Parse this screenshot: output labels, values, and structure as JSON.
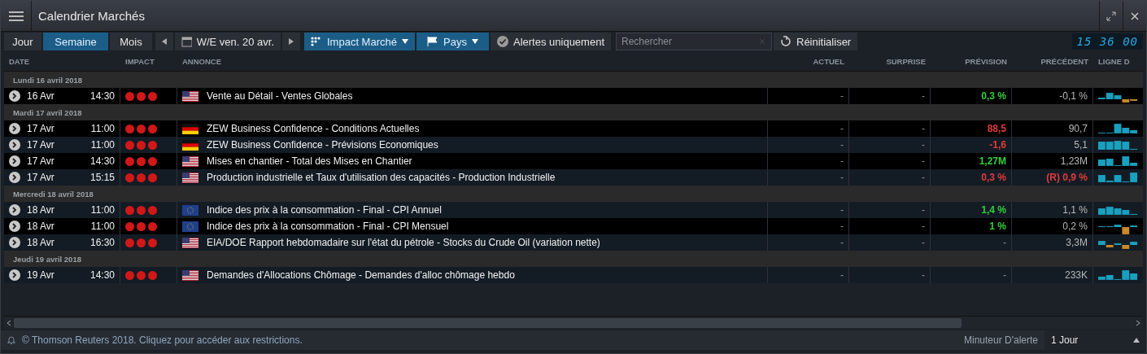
{
  "window": {
    "title": "Calendrier Marchés"
  },
  "toolbar": {
    "periods": [
      {
        "label": "Jour",
        "selected": false
      },
      {
        "label": "Semaine",
        "selected": true
      },
      {
        "label": "Mois",
        "selected": false
      }
    ],
    "date": "W/E ven. 20 avr.",
    "impact_filter": "Impact Marché",
    "country_filter": "Pays",
    "alerts": "Alertes uniquement",
    "search": {
      "placeholder": "Rechercher"
    },
    "reset": "Réinitialiser",
    "clock": "15 36 00"
  },
  "table": {
    "columns": [
      "DATE",
      "IMPACT",
      "ANNONCE",
      "ACTUEL",
      "SURPRISE",
      "PRÉVISION",
      "PRÉCÉDENT",
      "LIGNE D"
    ],
    "groups": [
      {
        "title": "Lundi 16 avril 2018",
        "rows": [
          {
            "date": "16 Avr",
            "time": "14:30",
            "stars": 3,
            "flag": {
              "kind": "us"
            },
            "event": "Vente au Détail - Ventes Globales",
            "actual": "-",
            "surprise": "-",
            "forecast": {
              "text": "0,3 %",
              "color": "#2fd03a"
            },
            "previous": "-0,1 %",
            "revised": false,
            "highlighted": false
          }
        ]
      },
      {
        "title": "Mardi 17 avril 2018",
        "rows": [
          {
            "date": "17 Avr",
            "time": "11:00",
            "stars": 3,
            "flag": {
              "kind": "de"
            },
            "event": "ZEW Business Confidence - Conditions Actuelles",
            "actual": "-",
            "surprise": "-",
            "forecast": {
              "text": "88,5",
              "color": "#e23b3b"
            },
            "previous": "90,7",
            "revised": false,
            "highlighted": false
          },
          {
            "date": "17 Avr",
            "time": "11:00",
            "stars": 3,
            "flag": {
              "kind": "de"
            },
            "event": "ZEW Business Confidence - Prévisions Economiques",
            "actual": "-",
            "surprise": "-",
            "forecast": {
              "text": "-1,6",
              "color": "#e23b3b"
            },
            "previous": "5,1",
            "revised": false,
            "highlighted": true
          },
          {
            "date": "17 Avr",
            "time": "14:30",
            "stars": 3,
            "flag": {
              "kind": "us"
            },
            "event": "Mises en chantier - Total des Mises en Chantier",
            "actual": "-",
            "surprise": "-",
            "forecast": {
              "text": "1,27M",
              "color": "#2fd03a"
            },
            "previous": "1,23M",
            "revised": false,
            "highlighted": false
          },
          {
            "date": "17 Avr",
            "time": "15:15",
            "stars": 3,
            "flag": {
              "kind": "us"
            },
            "event": "Production industrielle et Taux d'utilisation des capacités - Production Industrielle",
            "actual": "-",
            "surprise": "-",
            "forecast": {
              "text": "0,3 %",
              "color": "#e23b3b"
            },
            "previous": "(R) 0,9 %",
            "revised": true,
            "highlighted": true
          }
        ]
      },
      {
        "title": "Mercredi 18 avril 2018",
        "rows": [
          {
            "date": "18 Avr",
            "time": "11:00",
            "stars": 3,
            "flag": {
              "kind": "eu"
            },
            "event": "Indice des prix à la consommation - Final - CPI Annuel",
            "actual": "-",
            "surprise": "-",
            "forecast": {
              "text": "1,4 %",
              "color": "#2fd03a"
            },
            "previous": "1,1 %",
            "revised": false,
            "highlighted": true
          },
          {
            "date": "18 Avr",
            "time": "11:00",
            "stars": 3,
            "flag": {
              "kind": "eu"
            },
            "event": "Indice des prix à la consommation - Final - CPI Mensuel",
            "actual": "-",
            "surprise": "-",
            "forecast": {
              "text": "1 %",
              "color": "#2fd03a"
            },
            "previous": "0,2 %",
            "revised": false,
            "highlighted": false
          },
          {
            "date": "18 Avr",
            "time": "16:30",
            "stars": 3,
            "flag": {
              "kind": "us"
            },
            "event": "EIA/DOE Rapport hebdomadaire sur l'état du pétrole - Stocks du Crude Oil (variation nette)",
            "actual": "-",
            "surprise": "-",
            "forecast": {
              "text": "-"
            },
            "previous": "3,3M",
            "revised": false,
            "highlighted": true
          }
        ]
      },
      {
        "title": "Jeudi 19 avril 2018",
        "rows": [
          {
            "date": "19 Avr",
            "time": "14:30",
            "stars": 3,
            "flag": {
              "kind": "us"
            },
            "event": "Demandes d'Allocations Chômage - Demandes d'alloc chômage hebdo",
            "actual": "-",
            "surprise": "-",
            "forecast": {
              "text": "-"
            },
            "previous": "233K",
            "revised": false,
            "highlighted": true
          }
        ]
      }
    ]
  },
  "status_bar": {
    "copyright": "© Thomson Reuters 2018. Cliquez pour accéder aux restrictions.",
    "timer_label": "Minuteur D'alerte",
    "timer_value": "1 Jour"
  }
}
